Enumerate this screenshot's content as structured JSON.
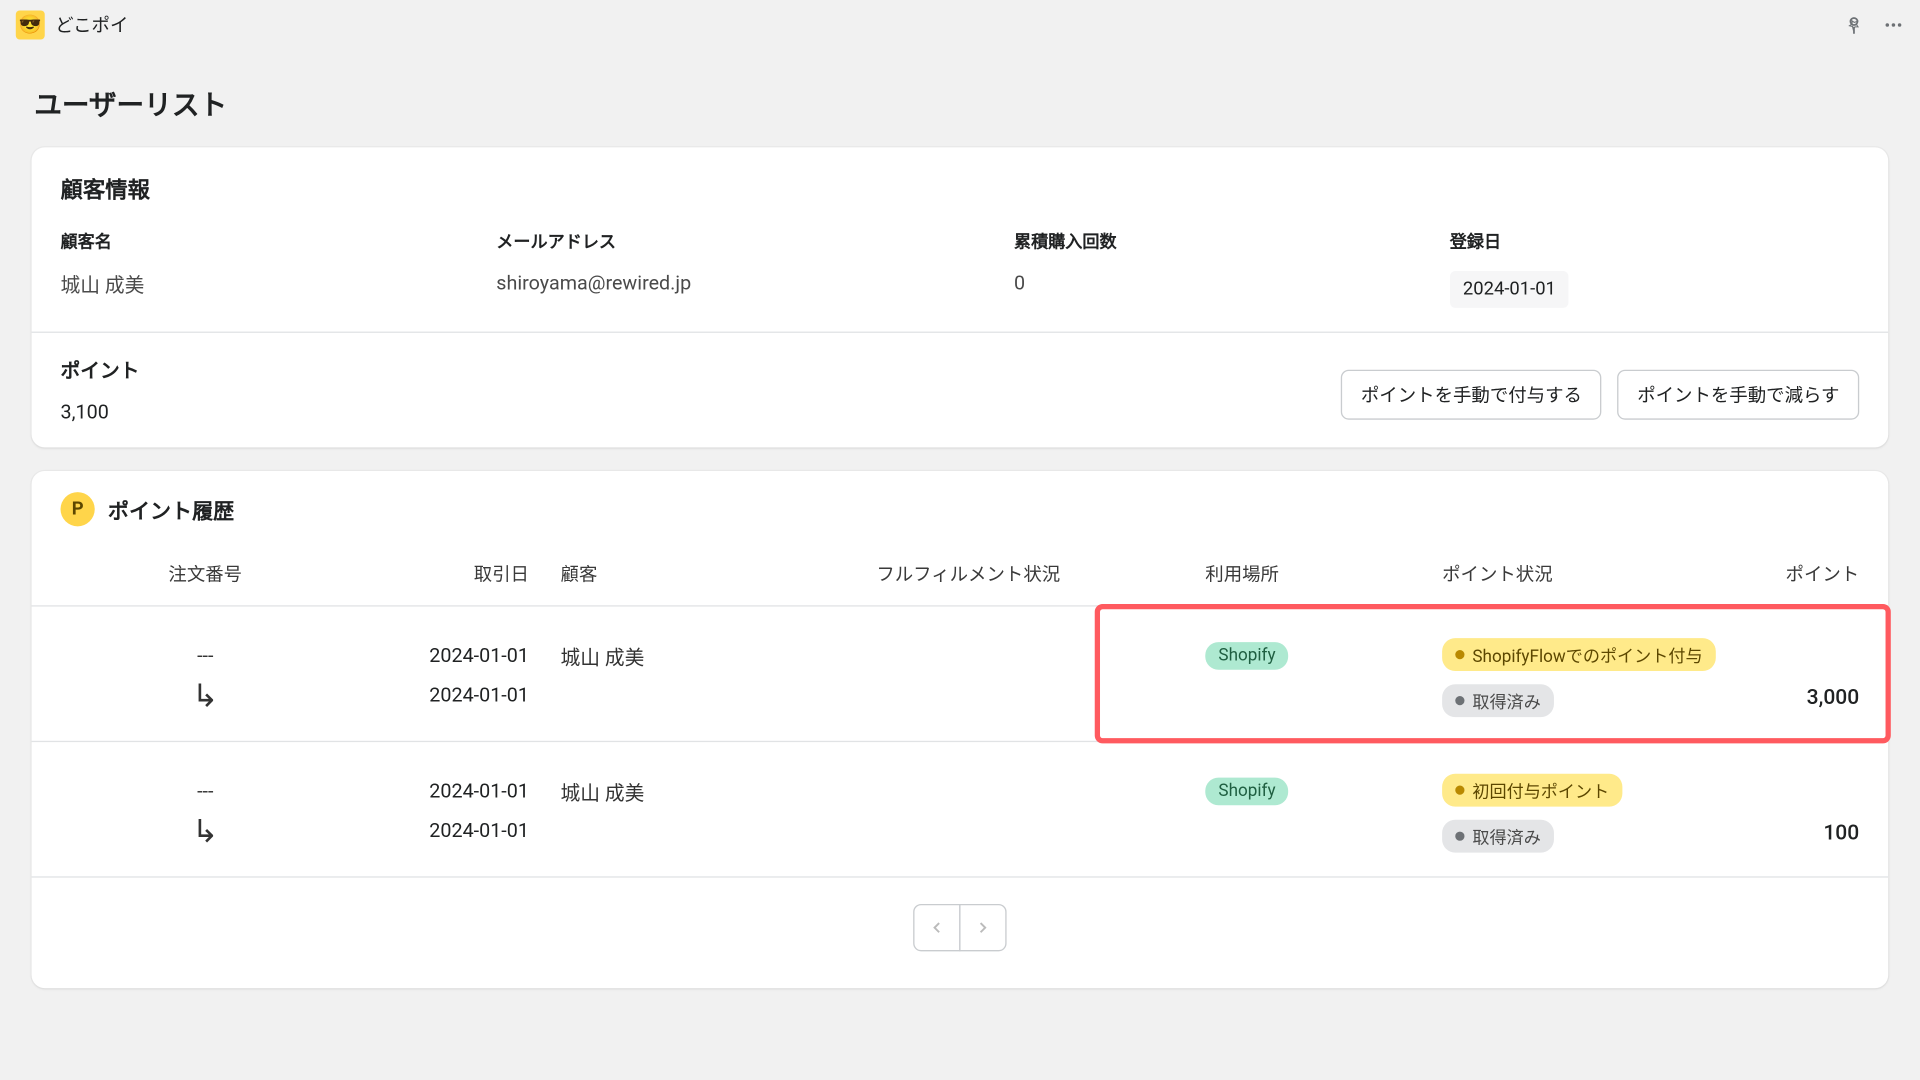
{
  "topbar": {
    "app_name": "どこポイ",
    "app_icon_glyph": "😎"
  },
  "page_title": "ユーザーリスト",
  "customer_info": {
    "section_title": "顧客情報",
    "labels": {
      "name": "顧客名",
      "email": "メールアドレス",
      "purchase_count": "累積購入回数",
      "registered": "登録日"
    },
    "values": {
      "name": "城山 成美",
      "email": "shiroyama@rewired.jp",
      "purchase_count": "0",
      "registered": "2024-01-01"
    }
  },
  "points": {
    "label": "ポイント",
    "value": "3,100",
    "btn_grant": "ポイントを手動で付与する",
    "btn_reduce": "ポイントを手動で減らす"
  },
  "history": {
    "title": "ポイント履歴",
    "badge": "P",
    "headers": {
      "order": "注文番号",
      "date": "取引日",
      "customer": "顧客",
      "fulfillment": "フルフィルメント状況",
      "location": "利用場所",
      "status": "ポイント状況",
      "points": "ポイント"
    },
    "rows": [
      {
        "highlight": true,
        "order_dash": "---",
        "date_primary": "2024-01-01",
        "date_secondary": "2024-01-01",
        "customer": "城山 成美",
        "location_pill": "Shopify",
        "status_pill_1": "ShopifyFlowでのポイント付与",
        "status_pill_2": "取得済み",
        "points": "3,000"
      },
      {
        "highlight": false,
        "order_dash": "---",
        "date_primary": "2024-01-01",
        "date_secondary": "2024-01-01",
        "customer": "城山 成美",
        "location_pill": "Shopify",
        "status_pill_1": "初回付与ポイント",
        "status_pill_2": "取得済み",
        "points": "100"
      }
    ]
  }
}
